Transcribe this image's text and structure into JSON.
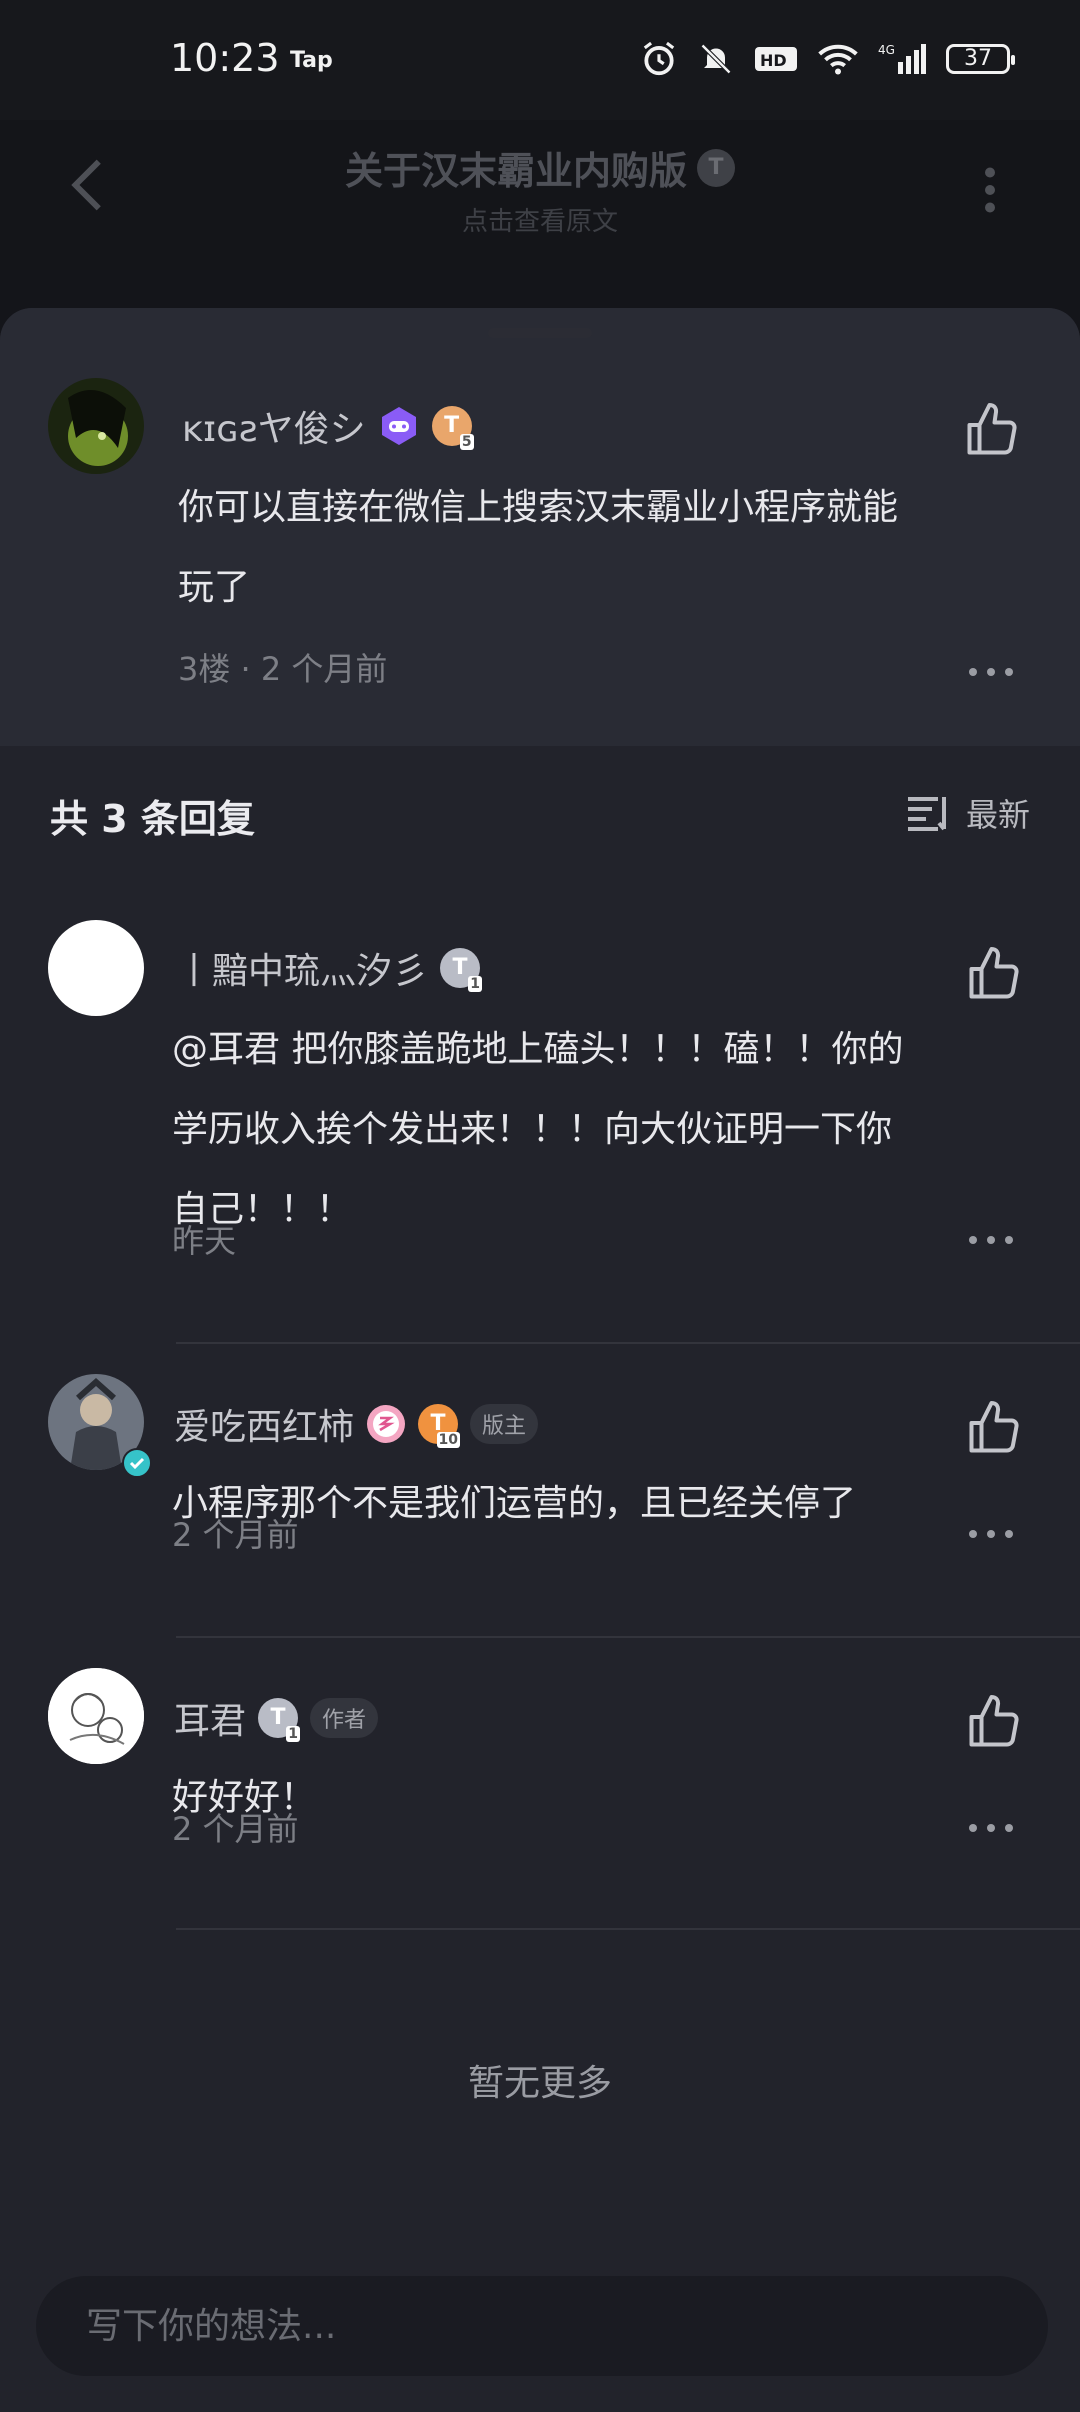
{
  "status_bar": {
    "time": "10:23",
    "app_tag": "Tap",
    "battery": "37"
  },
  "header": {
    "title": "关于汉末霸业内购版",
    "title_badge": "T",
    "subtitle": "点击查看原文"
  },
  "original_comment": {
    "author": "ĸɪɢƨヤ俊シ",
    "level_badge": "T",
    "level": "5",
    "text_line1": "你可以直接在微信上搜索汉末霸业小程序就能",
    "text_line2": "玩了",
    "meta": "3楼 · 2 个月前"
  },
  "replies_header": {
    "title": "共 3 条回复",
    "sort_label": "最新"
  },
  "replies": [
    {
      "author": "丨黯中琉灬汐彡",
      "level_badge": "T",
      "level": "1",
      "line1": "@耳君  把你膝盖跪地上磕头！！！磕！！你的",
      "line2": "学历收入挨个发出来！！！向大伙证明一下你",
      "line3": "自己！！！",
      "meta": "昨天"
    },
    {
      "author": "爱吃西红柿",
      "level_badge": "T",
      "level": "10",
      "tag": "版主",
      "line1": "小程序那个不是我们运营的，且已经关停了",
      "meta": "2 个月前"
    },
    {
      "author": "耳君",
      "level_badge": "T",
      "level": "1",
      "tag": "作者",
      "line1": "好好好！",
      "meta": "2 个月前"
    }
  ],
  "footer": {
    "no_more": "暂无更多",
    "input_placeholder": "写下你的想法..."
  },
  "colors": {
    "sheet_bg": "#22232b",
    "original_bg": "#292b34",
    "accent_orange": "#e9a66b",
    "accent_purple": "#8a5cf6",
    "verified_teal": "#36c3c9"
  }
}
